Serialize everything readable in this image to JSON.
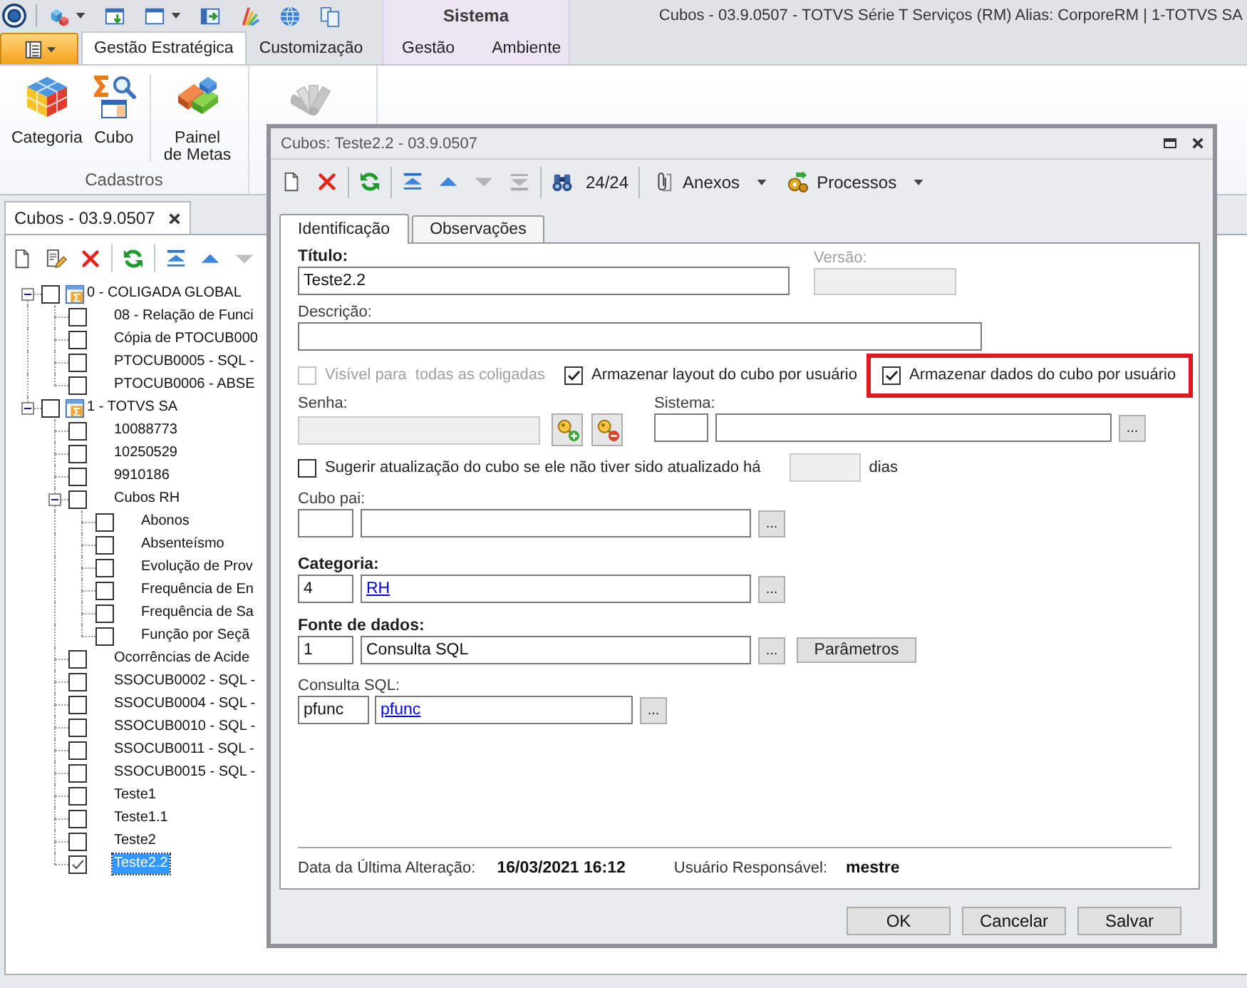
{
  "window": {
    "title": "Cubos - 03.9.0507 - TOTVS Série T Serviços (RM) Alias: CorporeRM | 1-TOTVS SA"
  },
  "ribbon": {
    "tabs": [
      {
        "label": "Gestão Estratégica",
        "selected": true
      },
      {
        "label": "Customização",
        "selected": false
      }
    ],
    "context_group": {
      "title": "Sistema",
      "tabs": [
        {
          "label": "Gestão",
          "selected": false
        },
        {
          "label": "Ambiente",
          "selected": false
        }
      ]
    },
    "groups": [
      {
        "label": "Cadastros",
        "buttons": [
          {
            "label": "Categoria",
            "disabled": false
          },
          {
            "label": "Cubo",
            "disabled": false
          },
          {
            "label": "Painel\nde Metas",
            "disabled": false
          }
        ]
      },
      {
        "buttons": [
          {
            "disabled": true
          }
        ]
      }
    ]
  },
  "document_tab": {
    "label": "Cubos - 03.9.0507",
    "selected": true
  },
  "tree_toolbar": [
    {
      "disabled": false
    },
    {
      "disabled": false
    },
    {
      "disabled": false
    },
    {
      "disabled": false
    },
    {
      "disabled": false
    },
    {
      "disabled": false
    },
    {
      "disabled": true
    }
  ],
  "tree": [
    {
      "label": "0 - COLIGADA GLOBAL",
      "checked": false,
      "selected": false,
      "expanded": true,
      "children": [
        {
          "label": "08 - Relação de Funci",
          "checked": false,
          "selected": false
        },
        {
          "label": "Cópia de PTOCUB000",
          "checked": false,
          "selected": false
        },
        {
          "label": "PTOCUB0005 - SQL -",
          "checked": false,
          "selected": false
        },
        {
          "label": "PTOCUB0006 - ABSE",
          "checked": false,
          "selected": false
        }
      ]
    },
    {
      "label": "1 - TOTVS SA",
      "checked": false,
      "selected": false,
      "expanded": true,
      "children": [
        {
          "label": "10088773",
          "checked": false,
          "selected": false
        },
        {
          "label": "10250529",
          "checked": false,
          "selected": false
        },
        {
          "label": "9910186",
          "checked": false,
          "selected": false
        },
        {
          "label": "Cubos RH",
          "checked": false,
          "selected": false,
          "expanded": true,
          "children": [
            {
              "label": "Abonos",
              "checked": false,
              "selected": false
            },
            {
              "label": "Absenteísmo",
              "checked": false,
              "selected": false
            },
            {
              "label": "Evolução de Prov",
              "checked": false,
              "selected": false
            },
            {
              "label": "Frequência de En",
              "checked": false,
              "selected": false
            },
            {
              "label": "Frequência de Sa",
              "checked": false,
              "selected": false
            },
            {
              "label": "Função por Seçã",
              "checked": false,
              "selected": false
            }
          ]
        },
        {
          "label": "Ocorrências de Acide",
          "checked": false,
          "selected": false
        },
        {
          "label": "SSOCUB0002 - SQL -",
          "checked": false,
          "selected": false
        },
        {
          "label": "SSOCUB0004 - SQL -",
          "checked": false,
          "selected": false
        },
        {
          "label": "SSOCUB0010 - SQL -",
          "checked": false,
          "selected": false
        },
        {
          "label": "SSOCUB0011 - SQL -",
          "checked": false,
          "selected": false
        },
        {
          "label": "SSOCUB0015 - SQL -",
          "checked": false,
          "selected": false
        },
        {
          "label": "Teste1",
          "checked": false,
          "selected": false
        },
        {
          "label": "Teste1.1",
          "checked": false,
          "selected": false
        },
        {
          "label": "Teste2",
          "checked": false,
          "selected": false
        },
        {
          "label": "Teste2.2",
          "checked": true,
          "selected": true
        }
      ]
    }
  ],
  "dialog": {
    "title": "Cubos: Teste2.2 - 03.9.0507",
    "toolbar": {
      "buttons": [
        {
          "disabled": false
        },
        {
          "disabled": false
        },
        {
          "disabled": false
        },
        {
          "disabled": false
        },
        {
          "disabled": false
        },
        {
          "disabled": true
        },
        {
          "disabled": true
        }
      ],
      "record_counter": "24/24",
      "menus": [
        "Anexos",
        "Processos"
      ]
    },
    "tabs": [
      {
        "label": "Identificação",
        "selected": true
      },
      {
        "label": "Observações",
        "selected": false
      }
    ],
    "form": {
      "title": {
        "label": "Título:",
        "required": true,
        "value": "Teste2.2"
      },
      "version": {
        "label": "Versão:",
        "disabled": true
      },
      "description": {
        "label": "Descrição:",
        "required": false
      },
      "options": [
        {
          "label": "Visível para  todas as coligadas",
          "checked": false,
          "disabled": true,
          "highlighted": false
        },
        {
          "label": "Armazenar layout do cubo por usuário",
          "checked": true,
          "disabled": false,
          "highlighted": false
        },
        {
          "label": "Armazenar dados do cubo por usuário",
          "checked": true,
          "disabled": false,
          "highlighted": true
        }
      ],
      "password": {
        "label": "Senha:",
        "disabled": true
      },
      "system": {
        "label": "Sistema:",
        "lookup": "..."
      },
      "suggest": {
        "label": "Sugerir atualização do cubo se ele não tiver sido atualizado há",
        "checked": false,
        "days_disabled": true,
        "unit": "dias"
      },
      "parent": {
        "label": "Cubo pai:",
        "required": false,
        "lookup": "..."
      },
      "category": {
        "label": "Categoria:",
        "required": true,
        "code": "4",
        "name": "RH",
        "link": true,
        "lookup": "..."
      },
      "source": {
        "label": "Fonte de dados:",
        "required": true,
        "code": "1",
        "name": "Consulta SQL",
        "link": false,
        "lookup": "...",
        "button": "Parâmetros"
      },
      "query": {
        "label": "Consulta SQL:",
        "required": false,
        "code": "pfunc",
        "name": "pfunc",
        "link": true,
        "lookup": "..."
      }
    },
    "footer": {
      "changed_label": "Data da Última Alteração:",
      "changed_value": "16/03/2021 16:12",
      "user_label": "Usuário Responsável:",
      "user_value": "mestre"
    },
    "buttons": [
      "OK",
      "Cancelar",
      "Salvar"
    ]
  }
}
